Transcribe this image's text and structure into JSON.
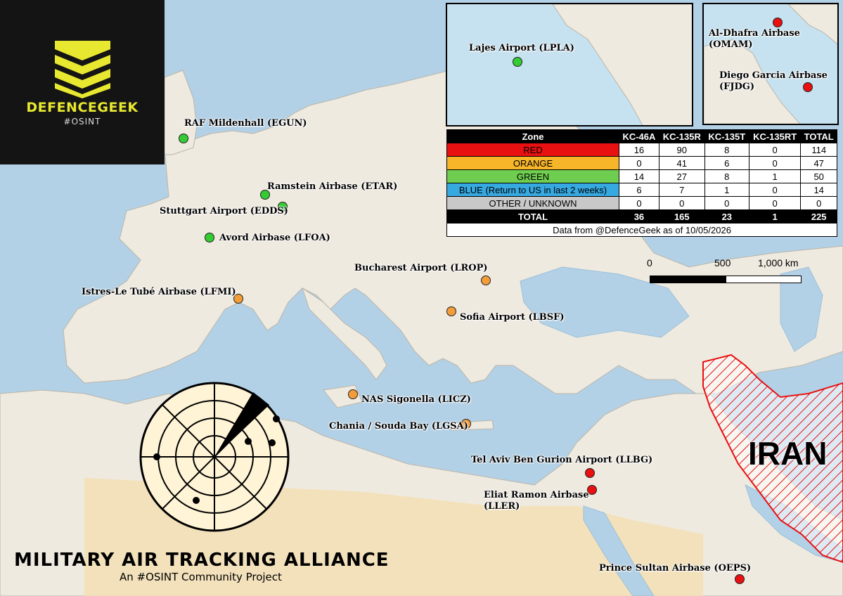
{
  "colors": {
    "sea": "#b3d1e6",
    "land": "#efeae0",
    "desert": "#f3dfb4",
    "green_zone": "#33cc33",
    "orange_zone": "#f39c3a",
    "red_zone": "#e81010",
    "blue_zone": "#36a9e1",
    "other_zone": "#c8c8c8",
    "logo_yellow": "#e8e830"
  },
  "logo": {
    "title": "DEFENCEGEEK",
    "subtitle": "#OSINT"
  },
  "airbases": [
    {
      "id": "egun",
      "label": "RAF Mildenhall (EGUN)",
      "zone": "green"
    },
    {
      "id": "etar",
      "label": "Ramstein Airbase (ETAR)",
      "zone": "green"
    },
    {
      "id": "edds",
      "label": "Stuttgart Airport (EDDS)",
      "zone": "green"
    },
    {
      "id": "lfoa",
      "label": "Avord Airbase (LFOA)",
      "zone": "green"
    },
    {
      "id": "lfmi",
      "label": "Istres-Le Tubé Airbase (LFMI)",
      "zone": "orange"
    },
    {
      "id": "lrop",
      "label": "Bucharest Airport (LROP)",
      "zone": "orange"
    },
    {
      "id": "lbsf",
      "label": "Sofia Airport (LBSF)",
      "zone": "orange"
    },
    {
      "id": "licz",
      "label": "NAS Sigonella (LICZ)",
      "zone": "orange"
    },
    {
      "id": "lgsa",
      "label": "Chania / Souda Bay (LGSA)",
      "zone": "orange"
    },
    {
      "id": "llbg",
      "label": "Tel Aviv Ben Gurion Airport (LLBG)",
      "zone": "red"
    },
    {
      "id": "ller_1",
      "label": "Eliat Ramon Airbase",
      "zone": "red"
    },
    {
      "id": "ller_2",
      "label": "(LLER)",
      "zone": "red"
    },
    {
      "id": "oeps",
      "label": "Prince Sultan Airbase (OEPS)",
      "zone": "red"
    }
  ],
  "insets": {
    "atlantic": {
      "label": "Lajes Airport (LPLA)",
      "zone": "green"
    },
    "indian": {
      "omam_line1": "Al-Dhafra Airbase",
      "omam_line2": "(OMAM)",
      "fjdg_line1": "Diego Garcia Airbase",
      "fjdg_line2": "(FJDG)"
    }
  },
  "table": {
    "headers": [
      "Zone",
      "KC-46A",
      "KC-135R",
      "KC-135T",
      "KC-135RT",
      "TOTAL"
    ],
    "rows": [
      {
        "zone": "RED",
        "color": "#e81010",
        "text_color": "#000000",
        "values": [
          "16",
          "90",
          "8",
          "0",
          "114"
        ]
      },
      {
        "zone": "ORANGE",
        "color": "#f7b52a",
        "text_color": "#000000",
        "values": [
          "0",
          "41",
          "6",
          "0",
          "47"
        ]
      },
      {
        "zone": "GREEN",
        "color": "#6fce4f",
        "text_color": "#000000",
        "values": [
          "14",
          "27",
          "8",
          "1",
          "50"
        ]
      },
      {
        "zone": "BLUE (Return to US in last 2 weeks)",
        "color": "#36a9e1",
        "text_color": "#000000",
        "values": [
          "6",
          "7",
          "1",
          "0",
          "14"
        ]
      },
      {
        "zone": "OTHER / UNKNOWN",
        "color": "#c8c8c8",
        "text_color": "#000000",
        "values": [
          "0",
          "0",
          "0",
          "0",
          "0"
        ]
      }
    ],
    "total": {
      "label": "TOTAL",
      "values": [
        "36",
        "165",
        "23",
        "1",
        "225"
      ]
    },
    "footer": "Data from @DefenceGeek as of 10/05/2026"
  },
  "scale_bar": {
    "labels": [
      "0",
      "500",
      "1,000 km"
    ]
  },
  "region_label": "IRAN",
  "footer": {
    "title": "MILITARY AIR TRACKING ALLIANCE",
    "subtitle": "An #OSINT Community Project"
  }
}
